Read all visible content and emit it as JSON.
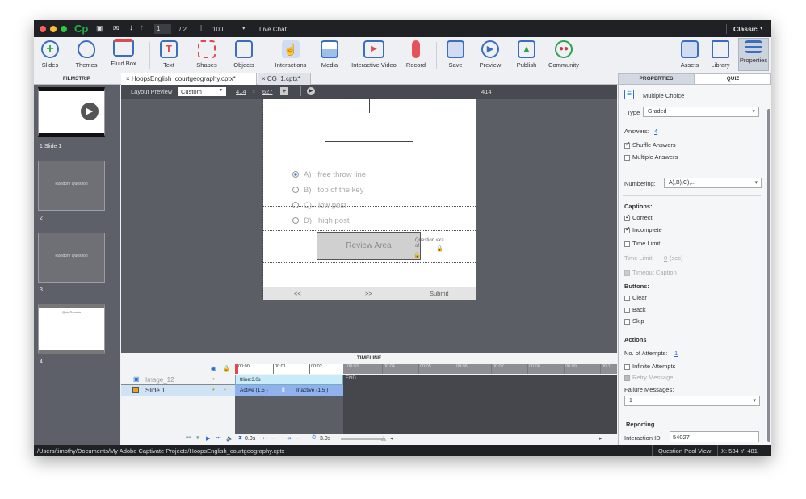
{
  "titlebar": {
    "app_logo": "Cp",
    "page_current": "1",
    "page_total": "/ 2",
    "zoom": "100",
    "live_chat": "Live Chat",
    "workspace": "Classic"
  },
  "toolbar": {
    "items": [
      {
        "label": "Slides",
        "icon": "plus-circle-icon"
      },
      {
        "label": "Themes",
        "icon": "palette-icon"
      },
      {
        "label": "Fluid Box",
        "icon": "fluid-box-icon"
      },
      {
        "label": "Text",
        "icon": "text-icon"
      },
      {
        "label": "Shapes",
        "icon": "shapes-icon"
      },
      {
        "label": "Objects",
        "icon": "objects-icon"
      },
      {
        "label": "Interactions",
        "icon": "hand-pointer-icon"
      },
      {
        "label": "Media",
        "icon": "image-icon"
      },
      {
        "label": "Interactive Video",
        "icon": "interactive-video-icon"
      },
      {
        "label": "Record",
        "icon": "microphone-icon"
      },
      {
        "label": "Save",
        "icon": "floppy-icon"
      },
      {
        "label": "Preview",
        "icon": "play-circle-icon"
      },
      {
        "label": "Publish",
        "icon": "publish-icon"
      },
      {
        "label": "Community",
        "icon": "community-icon"
      },
      {
        "label": "Assets",
        "icon": "assets-icon"
      },
      {
        "label": "Library",
        "icon": "library-icon"
      },
      {
        "label": "Properties",
        "icon": "properties-icon"
      }
    ]
  },
  "filmstrip": {
    "title": "FILMSTRIP",
    "slides": [
      {
        "label": "1 Slide 1"
      },
      {
        "label": "2",
        "text": "Random Question"
      },
      {
        "label": "3",
        "text": "Random Question"
      },
      {
        "label": "4",
        "text": "Quiz Results"
      }
    ]
  },
  "tabs": [
    {
      "label": "HoopsEnglish_courtgeography.cptx*"
    },
    {
      "label": "CG_1.cptx*"
    }
  ],
  "stagebar": {
    "layout_preview": "Layout Preview",
    "preset": "Custom",
    "width": "414",
    "x": "×",
    "height": "627",
    "ruler_marker": "414"
  },
  "slide": {
    "options": [
      {
        "letter": "A)",
        "text": "free throw line",
        "selected": true
      },
      {
        "letter": "B)",
        "text": "top of the key",
        "selected": false
      },
      {
        "letter": "C)",
        "text": "low post",
        "selected": false
      },
      {
        "letter": "D)",
        "text": "high post",
        "selected": false
      }
    ],
    "review_area": "Review Area",
    "progress": "Question <x> of",
    "nav": {
      "back": "<<",
      "next": ">>",
      "submit": "Submit"
    }
  },
  "timeline": {
    "title": "TIMELINE",
    "ticks": [
      "00:00",
      "00:01",
      "00:02",
      "00:03",
      "00:04",
      "00:05",
      "00:06",
      "00:07",
      "00:08",
      "00:09",
      "00:1"
    ],
    "layers": [
      {
        "name": "Image_12",
        "bar": "ftline:3.0s"
      },
      {
        "name": "Slide 1",
        "active": "Active (1.5 )",
        "inactive": "Inactive (1.5 )"
      }
    ],
    "end": "END",
    "current_time": "0.0s",
    "start": "--",
    "duration_range": "--",
    "duration": "3.0s"
  },
  "properties": {
    "tabs": [
      "PROPERTIES",
      "QUIZ"
    ],
    "title": "Multiple Choice",
    "type_label": "Type",
    "type_value": "Graded",
    "answers_label": "Answers:",
    "answers_value": "4",
    "shuffle": "Shuffle Answers",
    "multiple": "Multiple Answers",
    "numbering_label": "Numbering:",
    "numbering_value": "A),B),C),...",
    "captions_label": "Captions:",
    "correct": "Correct",
    "incomplete": "Incomplete",
    "time_limit": "Time Limit",
    "time_limit_label": "Time Limit:",
    "time_limit_value": "0",
    "time_limit_unit": "(sec)",
    "timeout_caption": "Timeout Caption",
    "buttons_label": "Buttons:",
    "clear": "Clear",
    "back": "Back",
    "skip": "Skip",
    "actions_label": "Actions",
    "attempts_label": "No. of Attempts:",
    "attempts_value": "1",
    "infinite": "Infinite Attempts",
    "retry": "Retry Message",
    "failure_label": "Failure Messages:",
    "failure_value": "1",
    "reporting_label": "Reporting",
    "interaction_label": "Interaction ID",
    "interaction_value": "54027"
  },
  "status": {
    "path": "/Users/timothy/Documents/My Adobe Captivate Projects/HoopsEnglish_courtgeography.cptx",
    "pool": "Question Pool View",
    "coords": "X: 534 Y: 481"
  }
}
